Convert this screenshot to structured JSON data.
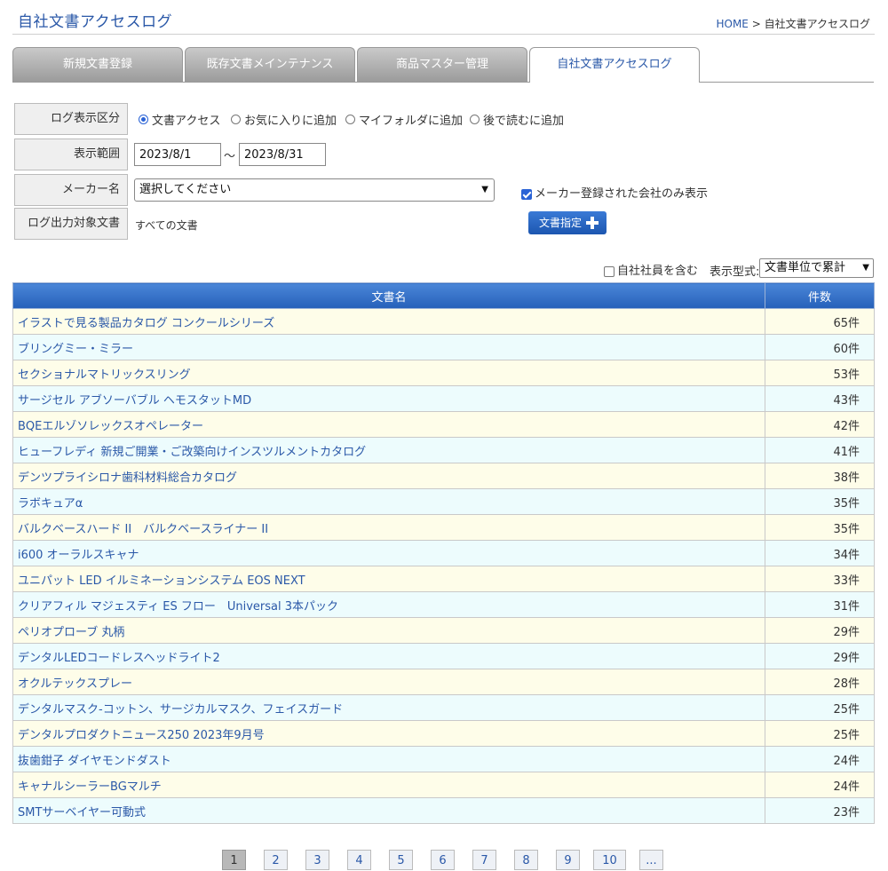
{
  "header": {
    "title": "自社文書アクセスログ",
    "breadcrumb_home": "HOME",
    "breadcrumb_sep": ">",
    "breadcrumb_current": "自社文書アクセスログ"
  },
  "tabs": [
    {
      "label": "新規文書登録",
      "active": false
    },
    {
      "label": "既存文書メインテナンス",
      "active": false
    },
    {
      "label": "商品マスター管理",
      "active": false
    },
    {
      "label": "自社文書アクセスログ",
      "active": true
    }
  ],
  "form": {
    "log_type": {
      "label": "ログ表示区分",
      "options": [
        "文書アクセス",
        "お気に入りに追加",
        "マイフォルダに追加",
        "後で読むに追加"
      ],
      "selected": "文書アクセス"
    },
    "date_range": {
      "label": "表示範囲",
      "from": "2023/8/1",
      "separator": "～",
      "to": "2023/8/31"
    },
    "maker": {
      "label": "メーカー名",
      "selected": "選択してください",
      "checkbox_label": "メーカー登録された会社のみ表示",
      "checked": true
    },
    "target_doc": {
      "label": "ログ出力対象文書",
      "value": "すべての文書",
      "button_label": "文書指定"
    }
  },
  "options": {
    "include_employees_label": "自社社員を含む",
    "include_employees_checked": false,
    "display_format_label": "表示型式:",
    "display_format_selected": "文書単位で累計"
  },
  "table": {
    "columns": [
      "文書名",
      "件数"
    ],
    "rows": [
      {
        "name": "イラストで見る製品カタログ コンクールシリーズ",
        "count": "65件"
      },
      {
        "name": "ブリングミー・ミラー",
        "count": "60件"
      },
      {
        "name": "セクショナルマトリックスリング",
        "count": "53件"
      },
      {
        "name": "サージセル アブソーバブル ヘモスタットMD",
        "count": "43件"
      },
      {
        "name": "BQEエルゾソレックスオペレーター",
        "count": "42件"
      },
      {
        "name": "ヒューフレディ 新規ご開業・ご改築向けインスツルメントカタログ",
        "count": "41件"
      },
      {
        "name": "デンツプライシロナ歯科材料総合カタログ",
        "count": "38件"
      },
      {
        "name": "ラボキュアα",
        "count": "35件"
      },
      {
        "name": "バルクベースハード II　バルクベースライナー II",
        "count": "35件"
      },
      {
        "name": "i600 オーラルスキャナ",
        "count": "34件"
      },
      {
        "name": "ユニパット LED イルミネーションシステム EOS NEXT",
        "count": "33件"
      },
      {
        "name": "クリアフィル マジェスティ ES フロー　Universal 3本パック",
        "count": "31件"
      },
      {
        "name": "ペリオプローブ 丸柄",
        "count": "29件"
      },
      {
        "name": "デンタルLEDコードレスヘッドライト2",
        "count": "29件"
      },
      {
        "name": "オクルテックスプレー",
        "count": "28件"
      },
      {
        "name": "デンタルマスク-コットン、サージカルマスク、フェイスガード",
        "count": "25件"
      },
      {
        "name": "デンタルプロダクトニュース250 2023年9月号",
        "count": "25件"
      },
      {
        "name": "抜歯鉗子 ダイヤモンドダスト",
        "count": "24件"
      },
      {
        "name": "キャナルシーラーBGマルチ",
        "count": "24件"
      },
      {
        "name": "SMTサーベイヤー可動式",
        "count": "23件"
      }
    ]
  },
  "pagination": {
    "pages": [
      "1",
      "2",
      "3",
      "4",
      "5",
      "6",
      "7",
      "8",
      "9",
      "10",
      "..."
    ],
    "current": "1"
  },
  "colors": {
    "link": "#2a58a8",
    "header_blue": "#2660b9",
    "row_odd": "#fefde9",
    "row_even": "#edfcfd"
  }
}
